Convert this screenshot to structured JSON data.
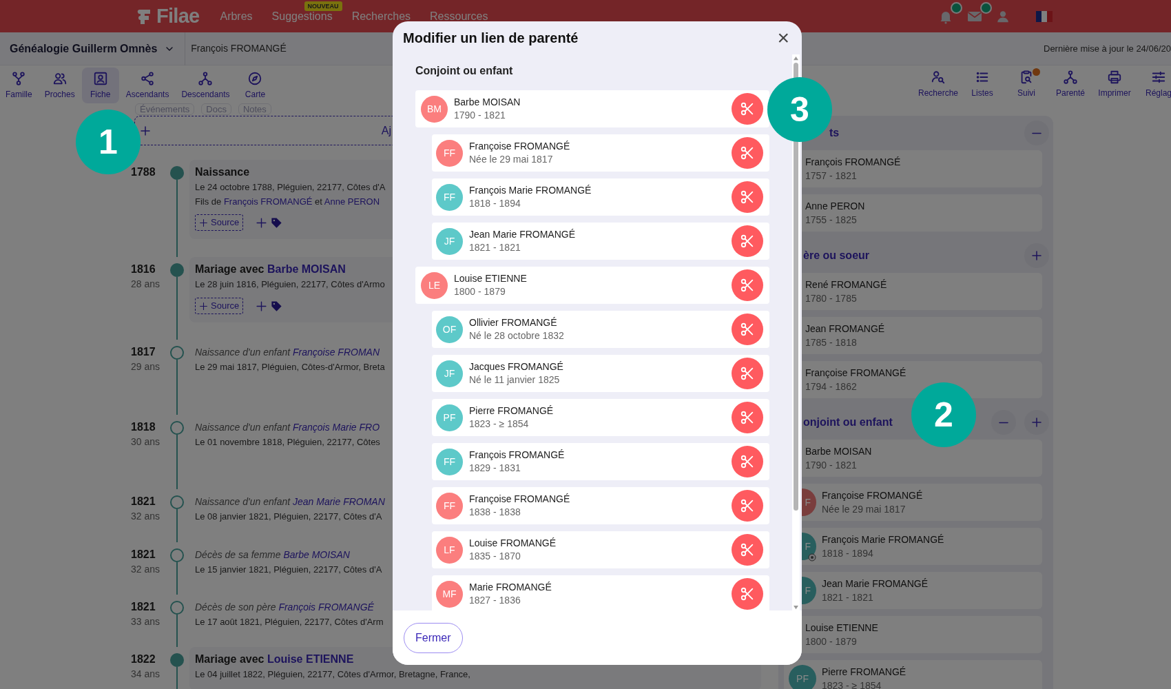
{
  "top_nav": {
    "logo": "Filae",
    "links": [
      {
        "label": "Arbres"
      },
      {
        "label": "Suggestions",
        "badge": "NOUVEAU"
      },
      {
        "label": "Recherches"
      },
      {
        "label": "Ressources"
      }
    ],
    "icons": [
      {
        "kind": "bell",
        "unread": true
      },
      {
        "kind": "mail",
        "unread": true
      },
      {
        "kind": "user",
        "unread": false
      },
      {
        "kind": "flag",
        "unread": false
      }
    ]
  },
  "subheader": {
    "tree": "Généalogie Guillerm Omnès",
    "person": "François FROMANGÉ",
    "updated": "Dernière mise à jour le 24/06/20"
  },
  "toolbar_left": [
    {
      "label": "Famille",
      "selected": false
    },
    {
      "label": "Proches",
      "selected": false
    },
    {
      "label": "Fiche",
      "selected": true
    },
    {
      "label": "Ascendants",
      "selected": false
    },
    {
      "label": "Descendants",
      "selected": false
    },
    {
      "label": "Carte",
      "selected": false
    }
  ],
  "ghost_tabs": [
    "Événements",
    "Docs",
    "Notes"
  ],
  "toolbar_right": [
    {
      "label": "Recherche",
      "dot": false
    },
    {
      "label": "Listes",
      "dot": false
    },
    {
      "label": "Suivi",
      "dot": true
    },
    {
      "label": "Parenté",
      "dot": false
    },
    {
      "label": "Imprimer",
      "dot": false
    },
    {
      "label": "Réglag",
      "dot": false
    }
  ],
  "add_event": {
    "label": "Aj"
  },
  "timeline": [
    {
      "year": "1788",
      "kind": "event",
      "title": "Naissance",
      "details": [
        "Le 24 octobre 1788, Pléguien, 22177, Côtes d'A"
      ],
      "parents": {
        "prefix": "Fils de",
        "father": "François FROMANGÉ",
        "joiner": "et",
        "mother": "Anne PERON"
      },
      "source": "Source"
    },
    {
      "year": "1816",
      "age": "28 ans",
      "kind": "event",
      "title": "Mariage avec",
      "link": "Barbe MOISAN",
      "details": [
        "Le 28 juin 1816, Pléguien, 22177, Côtes d'Armo"
      ],
      "source": "Source"
    },
    {
      "year": "1817",
      "age": "29 ans",
      "kind": "related",
      "title": "Naissance d'un enfant",
      "link": "Françoise FROMAN",
      "details": [
        "Le 29 mai 1817, Pléguien, Côtes-d'Armor, Breta"
      ]
    },
    {
      "year": "1818",
      "age": "30 ans",
      "kind": "related",
      "title": "Naissance d'un enfant",
      "link": "François Marie FRO",
      "details": [
        "Le 01 novembre 1818, Pléguien, 22177, Côtes"
      ]
    },
    {
      "year": "1821",
      "age": "32 ans",
      "kind": "related",
      "title": "Naissance d'un enfant",
      "link": "Jean Marie FROMAN",
      "details": [
        "Le 08 janvier 1821, Pléguien, 22177, Côtes d'A"
      ]
    },
    {
      "year": "1821",
      "age": "32 ans",
      "kind": "related",
      "title": "Décès de sa femme",
      "link": "Barbe MOISAN",
      "details": [
        "Le 15 janvier 1821, Pléguien, 22177, Côtes d'A"
      ]
    },
    {
      "year": "1821",
      "age": "33 ans",
      "kind": "related",
      "title": "Décès de son père",
      "link": "François FROMANGÉ",
      "details": [
        "Le 17 août 1821, Pléguien, 22177, Côtes d'Arm"
      ]
    },
    {
      "year": "1822",
      "age": "34 ans",
      "kind": "event",
      "title": "Mariage avec",
      "link": "Louise ETIENNE",
      "details": [
        "Le 04 juillet 1822, Pléguien, 22177, Côtes d'Armor, Bretagne, France,"
      ]
    }
  ],
  "relatives": {
    "sections": [
      {
        "title": "ts",
        "kind": "parents",
        "people": [
          {
            "name": "François FROMANGÉ",
            "dates": "1757 - 1821"
          },
          {
            "name": "Anne PERON",
            "dates": "1755 - 1825"
          }
        ]
      },
      {
        "title": "ère ou soeur",
        "kind": "siblings",
        "people": [
          {
            "name": "René FROMANGÉ",
            "dates": "1780 - 1785"
          },
          {
            "name": "Jean FROMANGÉ",
            "dates": "1785 - 1818"
          },
          {
            "name": "Françoise FROMANGÉ",
            "dates": "1794 - 1862"
          }
        ]
      },
      {
        "title": "onjoint ou enfant",
        "kind": "family",
        "people": [
          {
            "name": "Barbe MOISAN",
            "dates": "1790 - 1821"
          },
          {
            "name": "Françoise FROMANGÉ",
            "dates": "Née le 29 mai 1817",
            "initials": "F",
            "color": "#7a3d3d",
            "marker": false
          },
          {
            "name": "François Marie FROMANGÉ",
            "dates": "1818 - 1894",
            "initials": "F",
            "color": "#285e5e",
            "marker": true
          },
          {
            "name": "Jean Marie FROMANGÉ",
            "dates": "1821 - 1821",
            "initials": "F",
            "color": "#285e5e",
            "marker": false
          },
          {
            "name": "Louise ETIENNE",
            "dates": "1800 - 1879"
          },
          {
            "name": "Pierre FROMANGÉ",
            "dates": "1823 - ≥ 1854",
            "initials": "PF",
            "color": "#285e5e",
            "marker": false
          }
        ]
      }
    ]
  },
  "dialog": {
    "title": "Modifier un lien de parenté",
    "close": "×",
    "section": "Conjoint ou enfant",
    "button": "Fermer",
    "people": [
      {
        "initials": "BM",
        "color": "#fb7e7e",
        "name": "Barbe MOISAN",
        "dates": "1790 - 1821",
        "children": [
          {
            "initials": "FF",
            "color": "#fb7e7e",
            "name": "Françoise FROMANGÉ",
            "dates": "Née le 29 mai 1817"
          },
          {
            "initials": "FF",
            "color": "#5dc9c9",
            "name": "François Marie FROMANGÉ",
            "dates": "1818 - 1894"
          },
          {
            "initials": "JF",
            "color": "#5dc9c9",
            "name": "Jean Marie FROMANGÉ",
            "dates": "1821 - 1821"
          }
        ]
      },
      {
        "initials": "LE",
        "color": "#fb7e7e",
        "name": "Louise ETIENNE",
        "dates": "1800 - 1879",
        "children": [
          {
            "initials": "OF",
            "color": "#5dc9c9",
            "name": "Ollivier FROMANGÉ",
            "dates": "Né le 28 octobre 1832"
          },
          {
            "initials": "JF",
            "color": "#5dc9c9",
            "name": "Jacques FROMANGÉ",
            "dates": "Né le 11 janvier 1825"
          },
          {
            "initials": "PF",
            "color": "#5dc9c9",
            "name": "Pierre FROMANGÉ",
            "dates": "1823 - ≥ 1854"
          },
          {
            "initials": "FF",
            "color": "#5dc9c9",
            "name": "François FROMANGÉ",
            "dates": "1829 - 1831"
          },
          {
            "initials": "FF",
            "color": "#fb7e7e",
            "name": "Françoise FROMANGÉ",
            "dates": "1838 - 1838"
          },
          {
            "initials": "LF",
            "color": "#fb7e7e",
            "name": "Louise FROMANGÉ",
            "dates": "1835 - 1870"
          },
          {
            "initials": "MF",
            "color": "#fb7e7e",
            "name": "Marie FROMANGÉ",
            "dates": "1827 - 1836"
          }
        ]
      }
    ]
  },
  "annotations": [
    {
      "label": "1"
    },
    {
      "label": "2"
    },
    {
      "label": "3"
    }
  ]
}
